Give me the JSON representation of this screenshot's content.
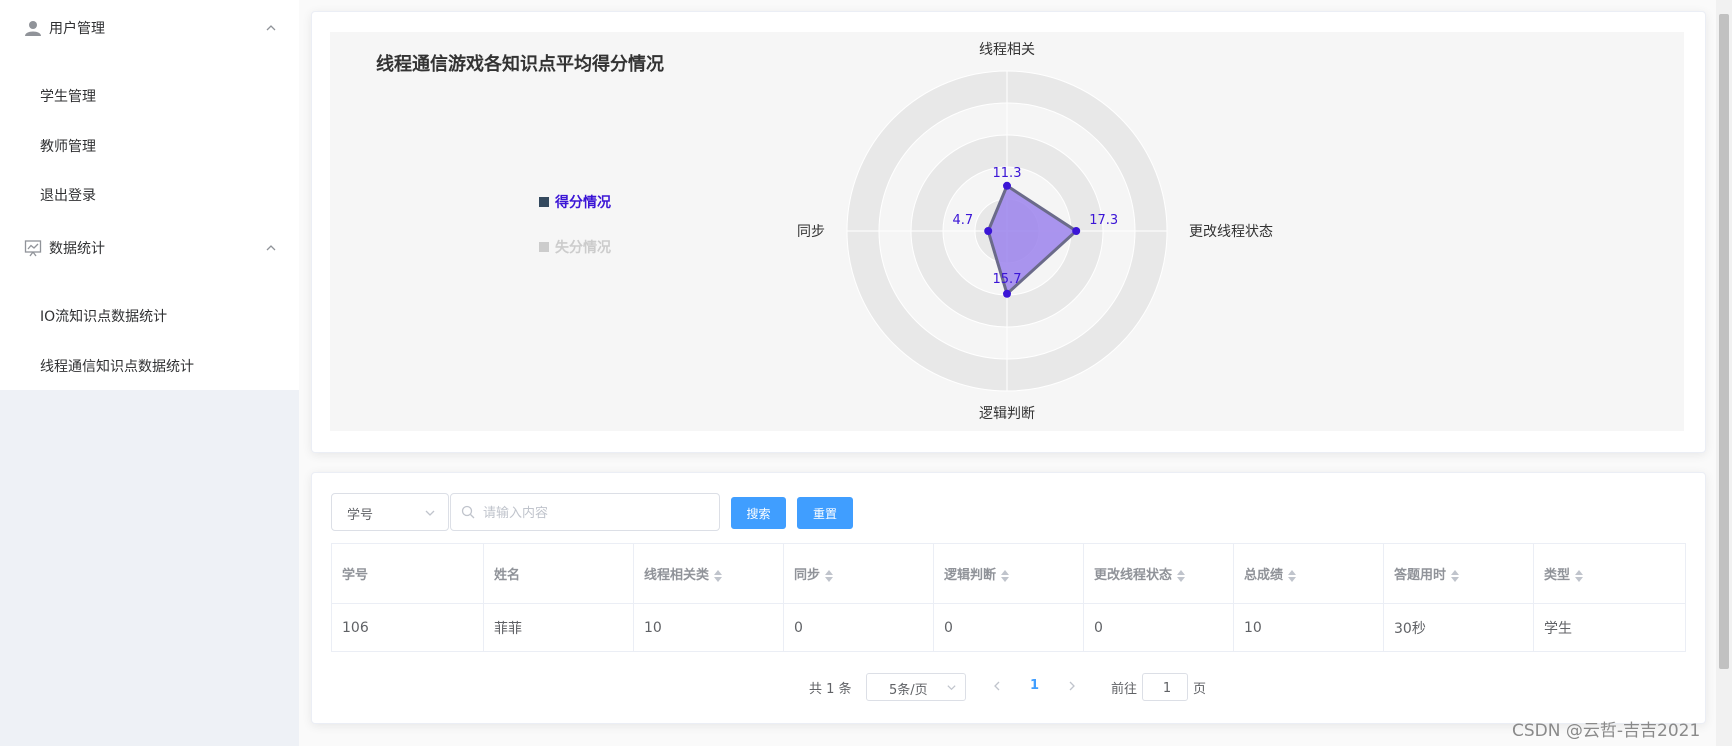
{
  "sidebar": {
    "groups": [
      {
        "title": "用户管理",
        "icon": "user-icon",
        "items": [
          "学生管理",
          "教师管理",
          "退出登录"
        ]
      },
      {
        "title": "数据统计",
        "icon": "chart-icon",
        "items": [
          "IO流知识点数据统计",
          "线程通信知识点数据统计"
        ]
      }
    ]
  },
  "chart_data": {
    "type": "radar",
    "title": "线程通信游戏各知识点平均得分情况",
    "indicators": [
      "线程相关",
      "更改线程状态",
      "逻辑判断",
      "同步"
    ],
    "series": [
      {
        "name": "得分情况",
        "values": [
          11.3,
          17.3,
          15.7,
          4.7
        ],
        "color": "#9b82ec",
        "line_color": "#3b15d6"
      },
      {
        "name": "失分情况",
        "values": [],
        "color": "#cccccc",
        "disabled": true
      }
    ],
    "max": 40,
    "legend": "left-middle"
  },
  "search": {
    "field_select": "学号",
    "placeholder": "请输入内容",
    "search_button": "搜索",
    "reset_button": "重置"
  },
  "table": {
    "columns": [
      "学号",
      "姓名",
      "线程相关类",
      "同步",
      "逻辑判断",
      "更改线程状态",
      "总成绩",
      "答题用时",
      "类型"
    ],
    "rows": [
      [
        "106",
        "菲菲",
        "10",
        "0",
        "0",
        "0",
        "10",
        "30秒",
        "学生"
      ]
    ]
  },
  "pagination": {
    "total": "共 1 条",
    "page_size": "5条/页",
    "current": "1",
    "goto_label": "前往",
    "goto_value": "1",
    "page_unit": "页"
  },
  "watermark": "CSDN @云哲-吉吉2021",
  "colors": {
    "primary": "#409eff",
    "radar_fill": "#9b82ec",
    "radar_line": "#3b15d6"
  }
}
